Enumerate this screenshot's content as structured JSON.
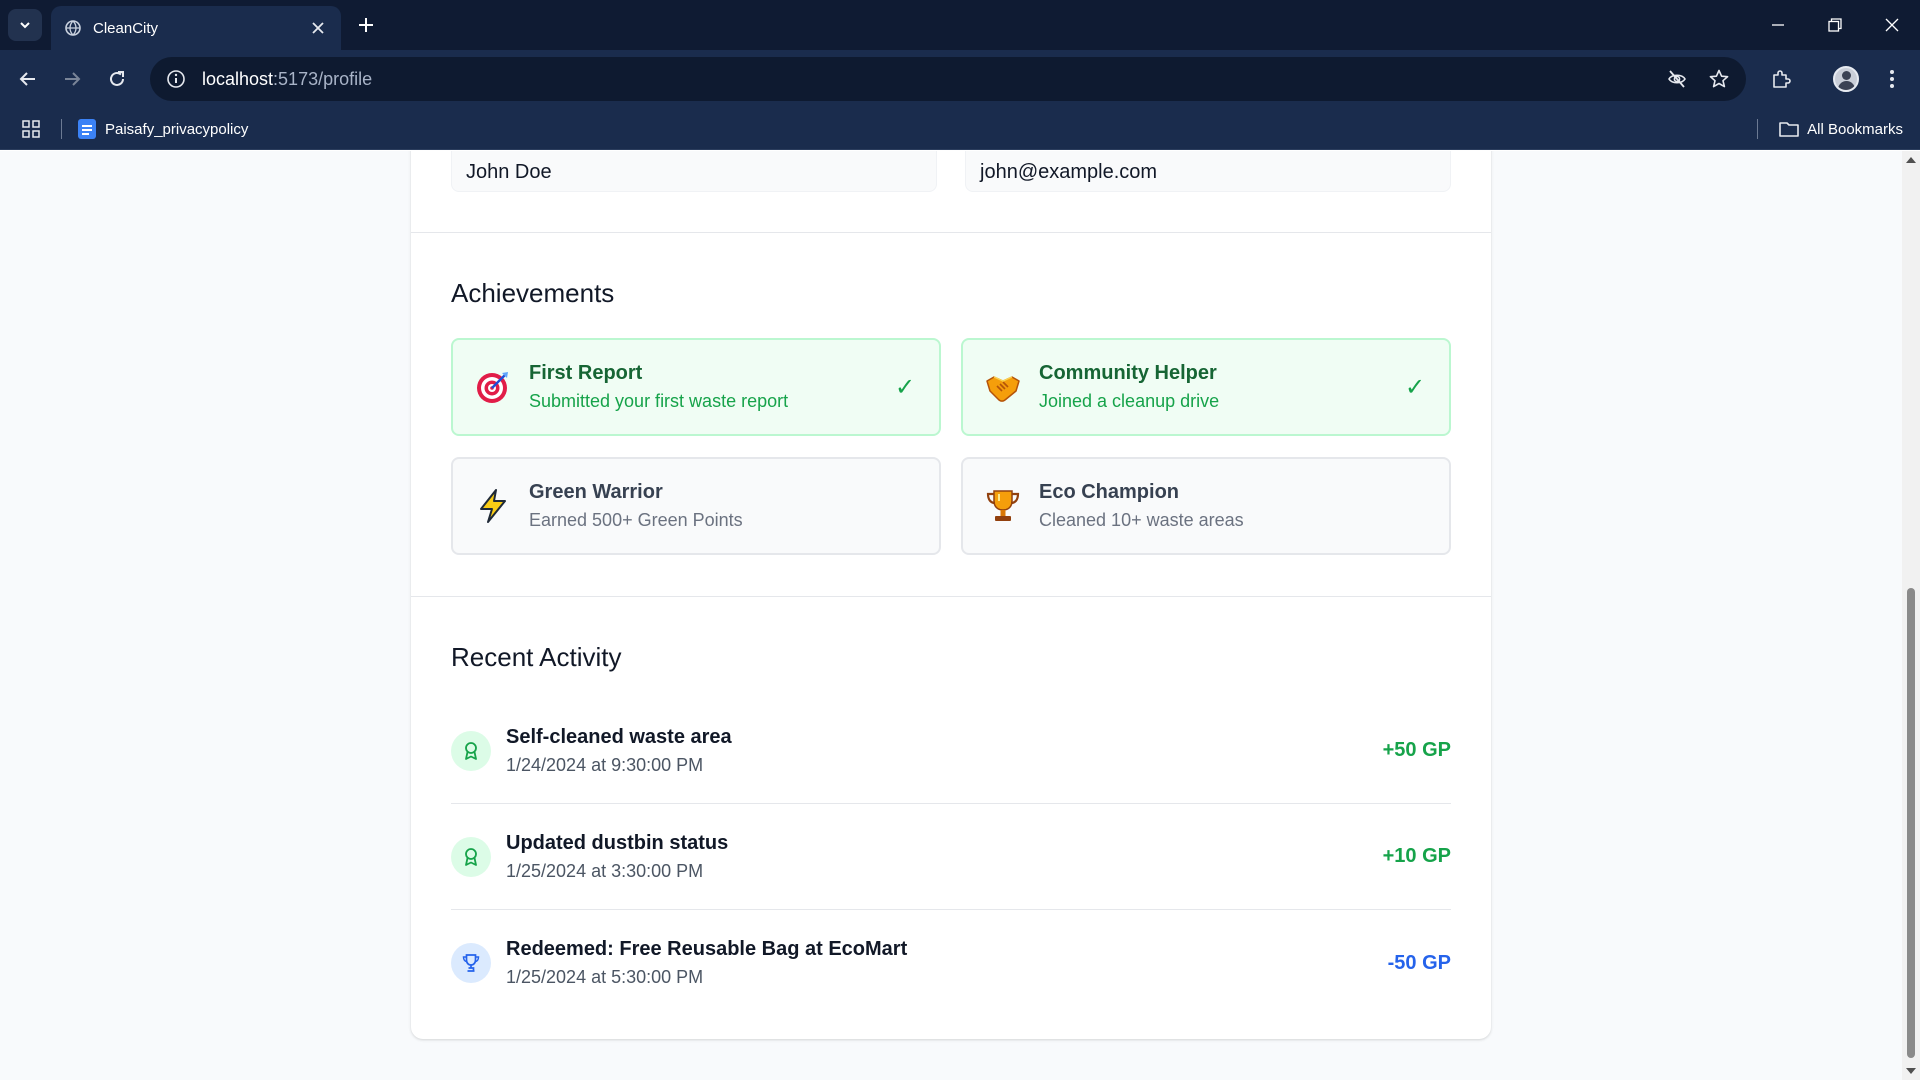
{
  "browser": {
    "tab_title": "CleanCity",
    "url_host": "localhost",
    "url_path": ":5173/profile",
    "bookmark_item": "Paisafy_privacypolicy",
    "all_bookmarks": "All Bookmarks"
  },
  "profile": {
    "name": "John Doe",
    "email": "john@example.com"
  },
  "achievements": {
    "title": "Achievements",
    "items": [
      {
        "title": "First Report",
        "description": "Submitted your first waste report",
        "status": "unlocked",
        "icon": "target-icon",
        "check": "✓"
      },
      {
        "title": "Community Helper",
        "description": "Joined a cleanup drive",
        "status": "unlocked",
        "icon": "handshake-icon",
        "check": "✓"
      },
      {
        "title": "Green Warrior",
        "description": "Earned 500+ Green Points",
        "status": "locked",
        "icon": "lightning-icon"
      },
      {
        "title": "Eco Champion",
        "description": "Cleaned 10+ waste areas",
        "status": "locked",
        "icon": "trophy-icon"
      }
    ]
  },
  "activity": {
    "title": "Recent Activity",
    "items": [
      {
        "title": "Self-cleaned waste area",
        "date": "1/24/2024 at 9:30:00 PM",
        "points": "+50 GP",
        "icon": "award-icon"
      },
      {
        "title": "Updated dustbin status",
        "date": "1/25/2024 at 3:30:00 PM",
        "points": "+10 GP",
        "icon": "award-icon"
      },
      {
        "title": "Redeemed: Free Reusable Bag at EcoMart",
        "date": "1/25/2024 at 5:30:00 PM",
        "points": "-50 GP",
        "icon": "trophy-icon"
      }
    ]
  },
  "colors": {
    "browser_frame": "#0f1b33",
    "toolbar": "#1a2c4d",
    "success": "#16a34a",
    "redeem": "#2563eb"
  }
}
